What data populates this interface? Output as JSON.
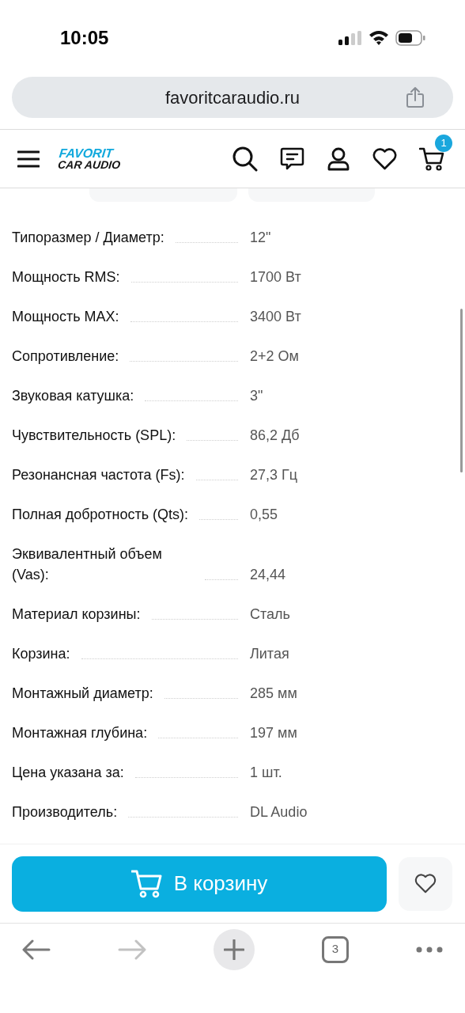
{
  "status_bar": {
    "time": "10:05"
  },
  "browser": {
    "url": "favoritcaraudio.ru",
    "tab_count": "3"
  },
  "site_header": {
    "logo_line_1": "FAVORIT",
    "logo_line_2": "CAR AUDIO",
    "cart_count": "1"
  },
  "specs": [
    {
      "label": "Типоразмер / Диаметр:",
      "value": "12\""
    },
    {
      "label": "Мощность RMS:",
      "value": "1700 Вт"
    },
    {
      "label": "Мощность MAX:",
      "value": "3400 Вт"
    },
    {
      "label": "Сопротивление:",
      "value": "2+2 Ом"
    },
    {
      "label": "Звуковая катушка:",
      "value": "3\""
    },
    {
      "label": "Чувствительность (SPL):",
      "value": "86,2 Дб"
    },
    {
      "label": "Резонансная частота (Fs):",
      "value": "27,3 Гц"
    },
    {
      "label": "Полная добротность (Qts):",
      "value": "0,55"
    },
    {
      "label": "Эквивалентный объем (Vas):",
      "value": "24,44"
    },
    {
      "label": "Материал корзины:",
      "value": "Сталь"
    },
    {
      "label": "Корзина:",
      "value": "Литая"
    },
    {
      "label": "Монтажный диаметр:",
      "value": "285 мм"
    },
    {
      "label": "Монтажная глубина:",
      "value": "197 мм"
    },
    {
      "label": "Цена указана за:",
      "value": "1 шт."
    },
    {
      "label": "Производитель:",
      "value": "DL Audio"
    }
  ],
  "add_to_cart": {
    "label": "В корзину"
  }
}
